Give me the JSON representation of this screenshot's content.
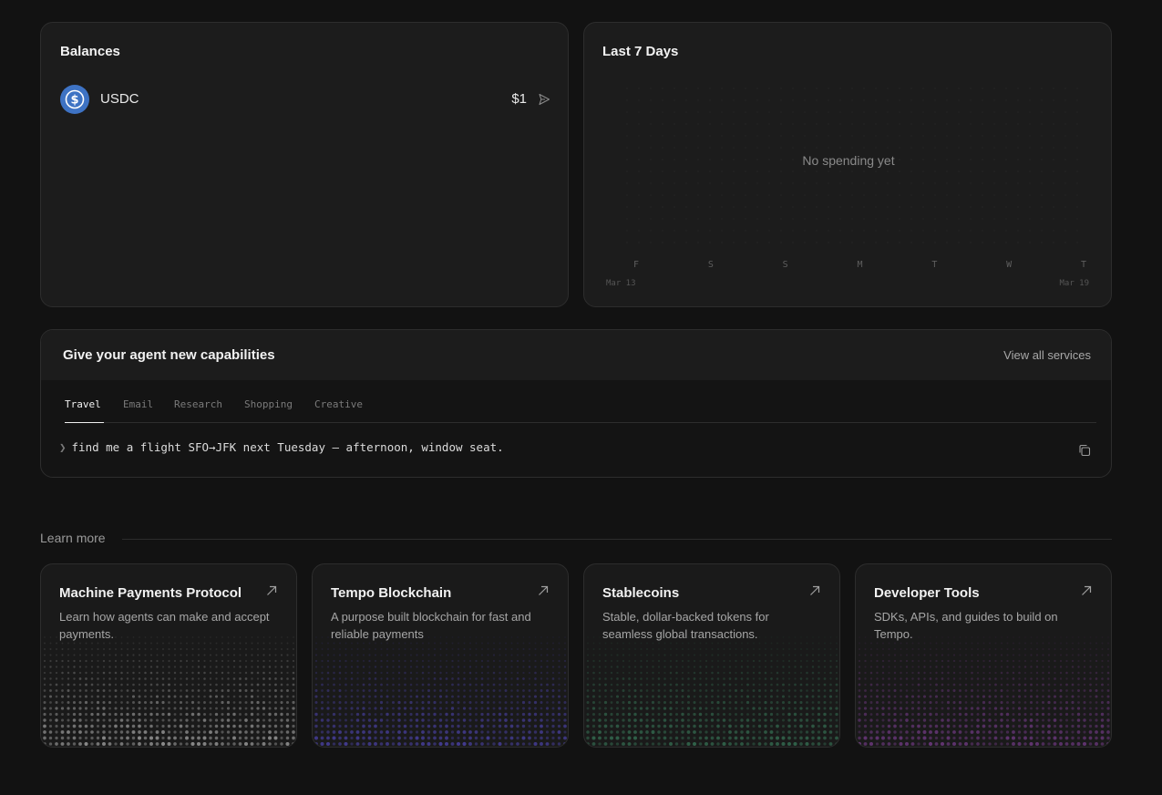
{
  "balances": {
    "title": "Balances",
    "assets": [
      {
        "name": "USDC",
        "value": "$1",
        "icon": "usdc-coin-icon"
      }
    ]
  },
  "last7": {
    "title": "Last 7 Days",
    "empty_message": "No spending yet",
    "days": [
      "F",
      "S",
      "S",
      "M",
      "T",
      "W",
      "T"
    ],
    "start_date": "Mar 13",
    "end_date": "Mar 19"
  },
  "capabilities": {
    "title": "Give your agent new capabilities",
    "view_all": "View all services",
    "tabs": [
      "Travel",
      "Email",
      "Research",
      "Shopping",
      "Creative"
    ],
    "active_tab": "Travel",
    "prompt": "find me a flight SFO→JFK next Tuesday — afternoon, window seat."
  },
  "learn_more": {
    "label": "Learn more",
    "cards": [
      {
        "title": "Machine Payments Protocol",
        "desc": "Learn how agents can make and accept payments.",
        "accent": "#d0d0d0"
      },
      {
        "title": "Tempo Blockchain",
        "desc": "A purpose built blockchain for fast and reliable payments",
        "accent": "#5b4fd6"
      },
      {
        "title": "Stablecoins",
        "desc": "Stable, dollar-backed tokens for seamless global transactions.",
        "accent": "#3f8f68"
      },
      {
        "title": "Developer Tools",
        "desc": "SDKs, APIs, and guides to build on Tempo.",
        "accent": "#8e45a8"
      }
    ]
  },
  "colors": {
    "background": "#121212",
    "card": "#1c1c1c",
    "usdc": "#3e73c4"
  }
}
